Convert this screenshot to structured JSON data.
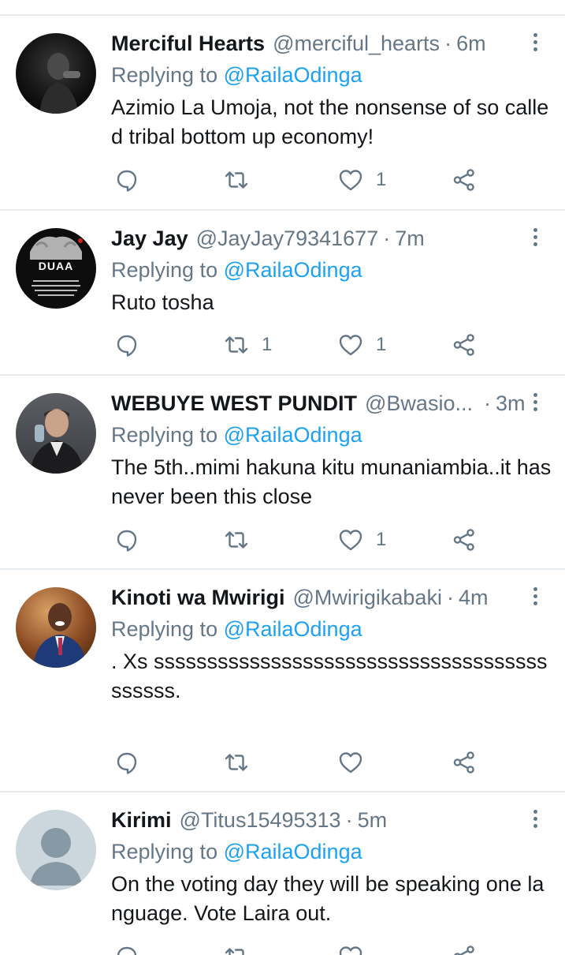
{
  "tweets": [
    {
      "name": "Merciful Hearts",
      "handle": "@merciful_hearts",
      "dot": "·",
      "time": "6m",
      "replying_prefix": "Replying to ",
      "replying_to": "@RailaOdinga",
      "text": "Azimio La Umoja, not the nonsense of so called tribal bottom up economy!",
      "retweets": "",
      "likes": "1",
      "avatar": "dark-portrait-avatar"
    },
    {
      "name": "Jay Jay",
      "handle": "@JayJay79341677",
      "dot": "·",
      "time": "7m",
      "replying_prefix": "Replying to ",
      "replying_to": "@RailaOdinga",
      "text": "Ruto tosha",
      "retweets": "1",
      "likes": "1",
      "avatar": "duaa-avatar",
      "avatar_text": "DUAA"
    },
    {
      "name": "WEBUYE WEST PUNDIT",
      "handle": "@Bwasio...",
      "dot": "·",
      "time": "3m",
      "replying_prefix": "Replying to ",
      "replying_to": "@RailaOdinga",
      "text": "The 5th..mimi hakuna kitu munaniambia..it has never been this close",
      "retweets": "",
      "likes": "1",
      "avatar": "man-drinking-avatar"
    },
    {
      "name": "Kinoti wa Mwirigi",
      "handle": "@Mwirigikabaki",
      "dot": "·",
      "time": "4m",
      "replying_prefix": "Replying to ",
      "replying_to": "@RailaOdinga",
      "text": ". Xs sssssssssssssssssssssssssssssssssssssssssss.",
      "retweets": "",
      "likes": "",
      "avatar": "man-in-suit-avatar"
    },
    {
      "name": "Kirimi",
      "handle": "@Titus15495313",
      "dot": "·",
      "time": "5m",
      "replying_prefix": "Replying to ",
      "replying_to": "@RailaOdinga",
      "text": "On the voting day they will be speaking one language. Vote Laira out.",
      "retweets": "",
      "likes": "",
      "avatar": "default-avatar"
    }
  ],
  "colors": {
    "link": "#1da1f2",
    "secondary_text": "#657786",
    "primary_text": "#14171a",
    "divider": "#e6ecf0"
  }
}
